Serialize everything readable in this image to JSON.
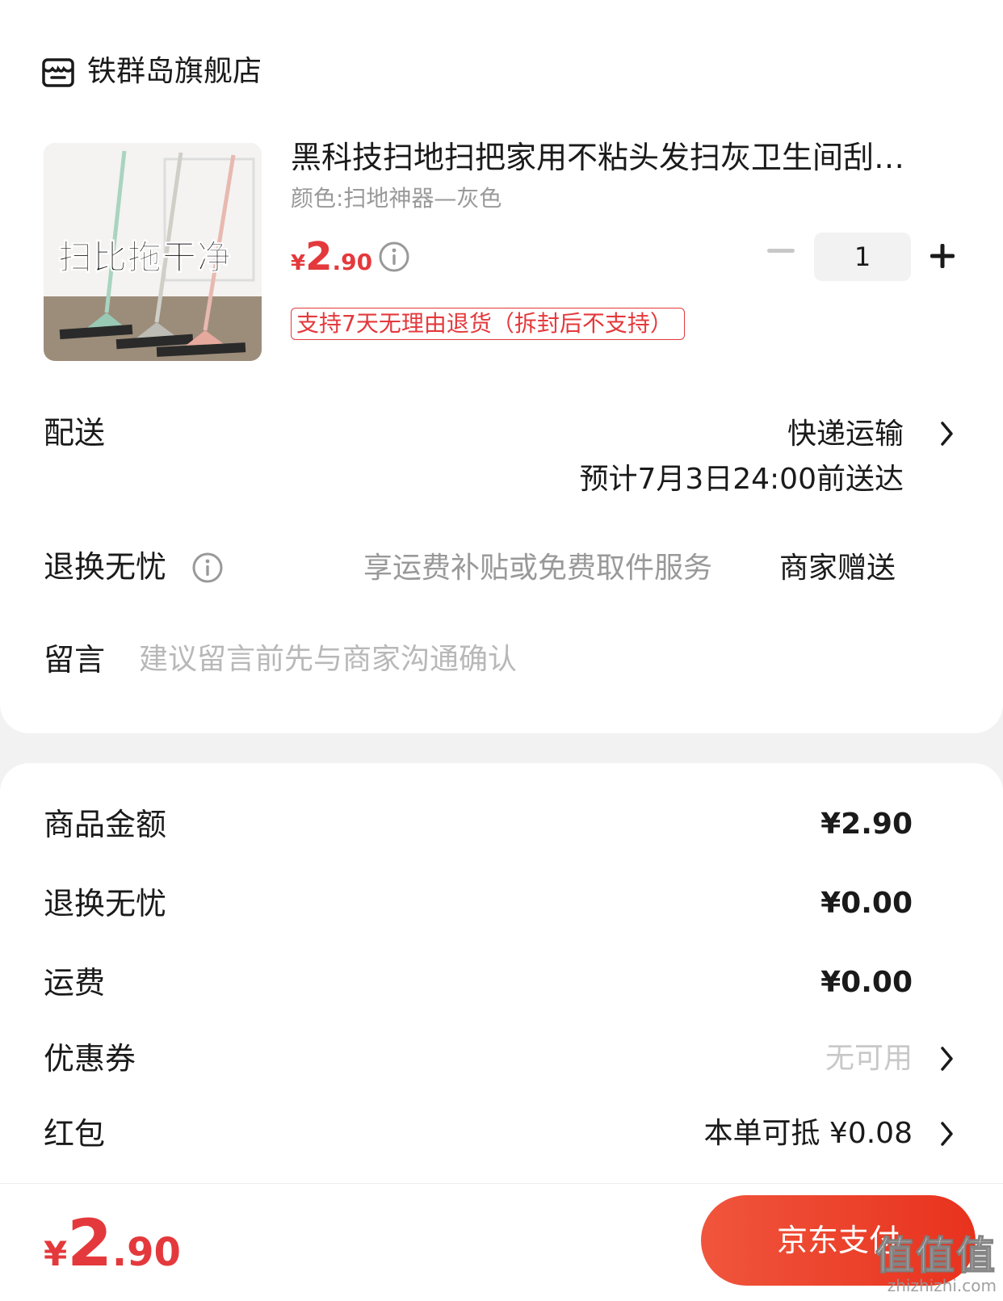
{
  "store": {
    "name": "铁群岛旗舰店"
  },
  "product": {
    "image_caption": "扫比拖干净",
    "title": "黑科技扫地扫把家用不粘头发扫灰卫生间刮…",
    "spec": "颜色:扫地神器—灰色",
    "price_yen": "¥",
    "price_int": "2",
    "price_dec": ".90",
    "quantity": "1",
    "return_tag": "支持7天无理由退货（拆封后不支持）"
  },
  "delivery": {
    "label": "配送",
    "method": "快递运输",
    "eta": "预计7月3日24:00前送达"
  },
  "worry_free": {
    "label": "退换无忧",
    "desc": "享运费补贴或免费取件服务",
    "value": "商家赠送"
  },
  "message": {
    "label": "留言",
    "placeholder": "建议留言前先与商家沟通确认"
  },
  "summary": {
    "goods_label": "商品金额",
    "goods_value": "¥2.90",
    "worry_label": "退换无忧",
    "worry_value": "¥0.00",
    "shipping_label": "运费",
    "shipping_value": "¥0.00",
    "coupon_label": "优惠券",
    "coupon_value": "无可用",
    "redpacket_label": "红包",
    "redpacket_value": "本单可抵 ¥0.08"
  },
  "footer": {
    "total_yen": "¥",
    "total_int": "2",
    "total_dec": ".90",
    "pay_label": "京东支付"
  },
  "watermark": {
    "logo": "值值值",
    "url": "zhizhizhi.com"
  },
  "colors": {
    "accent": "#e4393c",
    "pay_button": "#ea3b26",
    "muted": "#999999"
  }
}
